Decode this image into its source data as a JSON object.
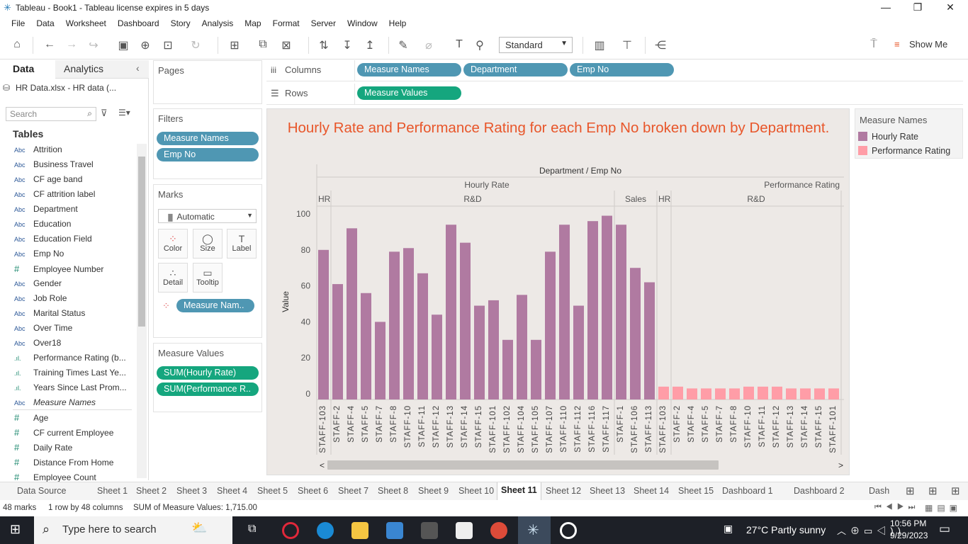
{
  "window": {
    "title": "Tableau - Book1 - Tableau license expires in 5 days"
  },
  "menu": [
    "File",
    "Data",
    "Worksheet",
    "Dashboard",
    "Story",
    "Analysis",
    "Map",
    "Format",
    "Server",
    "Window",
    "Help"
  ],
  "toolbar": {
    "fit": "Standard",
    "show_me": "Show Me"
  },
  "datapane": {
    "tab_data": "Data",
    "tab_analytics": "Analytics",
    "datasource": "HR Data.xlsx - HR data (...",
    "search_placeholder": "Search",
    "tables_heading": "Tables",
    "fields": [
      {
        "type": "Abc",
        "name": "Attrition"
      },
      {
        "type": "Abc",
        "name": "Business Travel"
      },
      {
        "type": "Abc",
        "name": "CF age band"
      },
      {
        "type": "Abc",
        "name": "CF attrition label"
      },
      {
        "type": "Abc",
        "name": "Department"
      },
      {
        "type": "Abc",
        "name": "Education"
      },
      {
        "type": "Abc",
        "name": "Education Field"
      },
      {
        "type": "Abc",
        "name": "Emp No"
      },
      {
        "type": "#",
        "name": "Employee Number"
      },
      {
        "type": "Abc",
        "name": "Gender"
      },
      {
        "type": "Abc",
        "name": "Job Role"
      },
      {
        "type": "Abc",
        "name": "Marital Status"
      },
      {
        "type": "Abc",
        "name": "Over Time"
      },
      {
        "type": "Abc",
        "name": "Over18"
      },
      {
        "type": ".ıl.",
        "name": "Performance Rating (b..."
      },
      {
        "type": ".ıl.",
        "name": "Training Times Last Ye..."
      },
      {
        "type": ".ıl.",
        "name": "Years Since Last Prom..."
      },
      {
        "type": "Abc",
        "name": "Measure Names"
      },
      {
        "type": "#",
        "name": "Age"
      },
      {
        "type": "#",
        "name": "CF current Employee"
      },
      {
        "type": "#",
        "name": "Daily Rate"
      },
      {
        "type": "#",
        "name": "Distance From Home"
      },
      {
        "type": "#",
        "name": "Employee Count"
      }
    ]
  },
  "cards": {
    "pages": "Pages",
    "filters": "Filters",
    "filter_pills": [
      "Measure Names",
      "Emp No"
    ],
    "marks": "Marks",
    "mark_type": "Automatic",
    "mark_buttons": [
      "Color",
      "Size",
      "Label",
      "Detail",
      "Tooltip"
    ],
    "mark_pill": "Measure Nam..",
    "measure_values": "Measure Values",
    "mv_pills": [
      "SUM(Hourly Rate)",
      "SUM(Performance R.."
    ]
  },
  "shelves": {
    "columns_label": "Columns",
    "columns": [
      "Measure Names",
      "Department",
      "Emp No"
    ],
    "rows_label": "Rows",
    "rows": [
      "Measure Values"
    ]
  },
  "legend": {
    "title": "Measure Names",
    "items": [
      {
        "name": "Hourly Rate",
        "color": "#b07aa1"
      },
      {
        "name": "Performance Rating",
        "color": "#ff9da7"
      }
    ]
  },
  "chart_data": {
    "type": "bar",
    "title": "Hourly Rate and Performance Rating for each Emp No broken down by Department.",
    "header_top": "Department / Emp No",
    "ylabel": "Value",
    "ylim": [
      0,
      100
    ],
    "yticks": [
      0,
      20,
      40,
      60,
      80,
      100
    ],
    "panes": [
      {
        "measure": "Hourly Rate",
        "color": "#b07aa1",
        "groups": [
          {
            "dept": "HR",
            "emps": [
              "STAFF-103"
            ],
            "values": [
              80
            ]
          },
          {
            "dept": "R&D",
            "emps": [
              "STAFF-2",
              "STAFF-4",
              "STAFF-5",
              "STAFF-7",
              "STAFF-8",
              "STAFF-10",
              "STAFF-11",
              "STAFF-12",
              "STAFF-13",
              "STAFF-14",
              "STAFF-15",
              "STAFF-101",
              "STAFF-102",
              "STAFF-104",
              "STAFF-105",
              "STAFF-107",
              "STAFF-110",
              "STAFF-112",
              "STAFF-116",
              "STAFF-117"
            ],
            "values": [
              61,
              92,
              56,
              40,
              79,
              81,
              67,
              44,
              94,
              84,
              49,
              52,
              30,
              55,
              30,
              79,
              94,
              49,
              96,
              99
            ]
          },
          {
            "dept": "Sales",
            "emps": [
              "STAFF-1",
              "STAFF-106",
              "STAFF-113"
            ],
            "values": [
              94,
              70,
              62
            ]
          }
        ]
      },
      {
        "measure": "Performance Rating",
        "color": "#ff9da7",
        "groups": [
          {
            "dept": "HR",
            "emps": [
              "STAFF-103"
            ],
            "values": [
              4
            ]
          },
          {
            "dept": "R&D",
            "emps": [
              "STAFF-2",
              "STAFF-4",
              "STAFF-5",
              "STAFF-7",
              "STAFF-8",
              "STAFF-10",
              "STAFF-11",
              "STAFF-12",
              "STAFF-13",
              "STAFF-14",
              "STAFF-15",
              "STAFF-101"
            ],
            "values": [
              4,
              3,
              3,
              3,
              3,
              4,
              4,
              4,
              3,
              3,
              3,
              3
            ]
          }
        ]
      }
    ]
  },
  "sheet_tabs": [
    "Data Source",
    "Sheet 1",
    "Sheet 2",
    "Sheet 3",
    "Sheet 4",
    "Sheet 5",
    "Sheet 6",
    "Sheet 7",
    "Sheet 8",
    "Sheet 9",
    "Sheet 10",
    "Sheet 11",
    "Sheet 12",
    "Sheet 13",
    "Sheet 14",
    "Sheet 15",
    "Dashboard 1",
    "Dashboard 2",
    "Dash"
  ],
  "active_tab": "Sheet 11",
  "status": {
    "marks": "48 marks",
    "shape": "1 row by 48 columns",
    "sum": "SUM of Measure Values: 1,715.00"
  },
  "taskbar": {
    "search": "Type here to search",
    "weather": "27°C  Partly sunny",
    "time": "10:56 PM",
    "date": "9/29/2023"
  }
}
